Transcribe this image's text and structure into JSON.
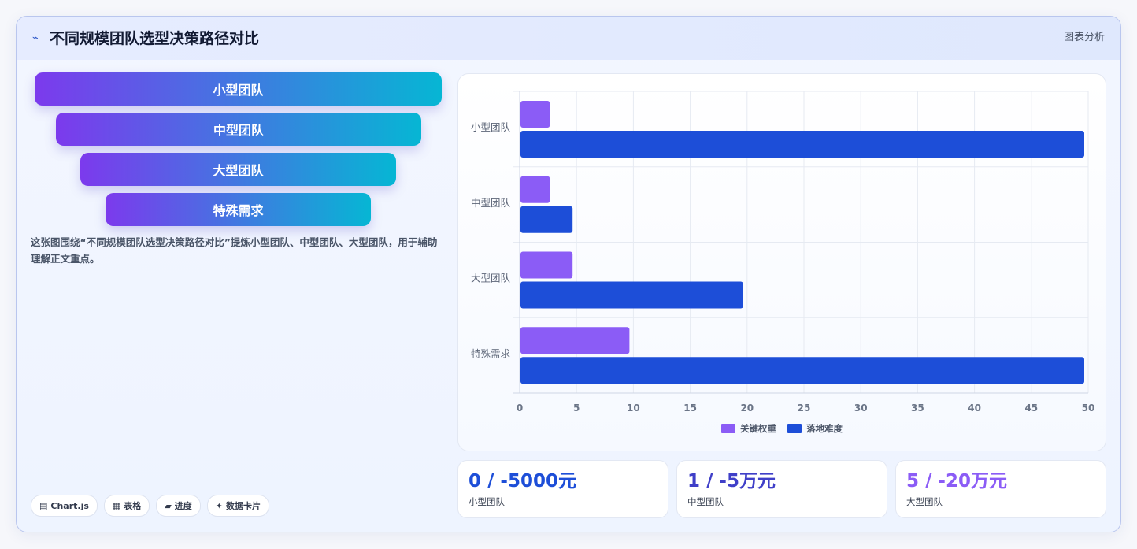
{
  "header": {
    "icon": "⌁",
    "title": "不同规模团队选型决策路径对比",
    "tag": "图表分析"
  },
  "funnel": {
    "items": [
      "小型团队",
      "中型团队",
      "大型团队",
      "特殊需求"
    ]
  },
  "description": "这张图围绕“不同规模团队选型决策路径对比”提炼小型团队、中型团队、大型团队，用于辅助理解正文重点。",
  "chips": [
    {
      "icon": "▤",
      "label": "Chart.js"
    },
    {
      "icon": "▦",
      "label": "表格"
    },
    {
      "icon": "▰",
      "label": "进度"
    },
    {
      "icon": "✦",
      "label": "数据卡片"
    }
  ],
  "stats": [
    {
      "value": "0 / -5000元",
      "label": "小型团队",
      "color": "#1d4ed8"
    },
    {
      "value": "1 / -5万元",
      "label": "中型团队",
      "color": "#3f3fc8"
    },
    {
      "value": "5 / -20万元",
      "label": "大型团队",
      "color": "#8b5cf6"
    }
  ],
  "chart_data": {
    "type": "bar",
    "orientation": "horizontal",
    "categories": [
      "小型团队",
      "中型团队",
      "大型团队",
      "特殊需求"
    ],
    "series": [
      {
        "name": "关键权重",
        "values": [
          3,
          3,
          5,
          10
        ],
        "color": "#8b5cf6"
      },
      {
        "name": "落地难度",
        "values": [
          50,
          5,
          20,
          50
        ],
        "color": "#1d4ed8"
      }
    ],
    "xlim": [
      0,
      50
    ],
    "xticks": [
      "0",
      "5",
      "10",
      "15",
      "20",
      "25",
      "30",
      "35",
      "40",
      "45",
      "50"
    ],
    "grid": true,
    "legend": "bottom"
  }
}
